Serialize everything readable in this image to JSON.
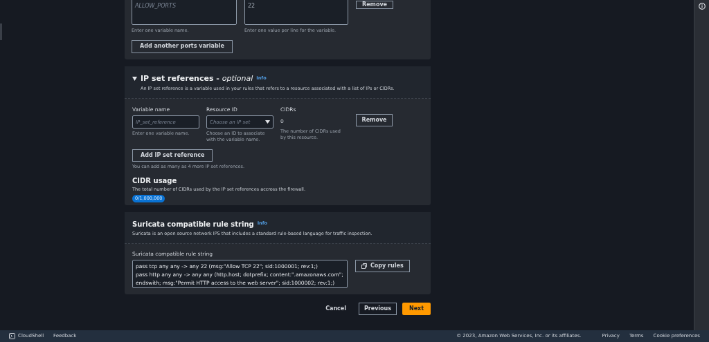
{
  "ports_section": {
    "variable_field": {
      "placeholder": "ALLOW_PORTS",
      "hint": "Enter one variable name."
    },
    "values_field": {
      "value": "22",
      "hint": "Enter one value per line for the variable."
    },
    "remove_button": "Remove",
    "add_button": "Add another ports variable"
  },
  "ip_set_section": {
    "expanded": true,
    "title": "IP set references - ",
    "title_suffix": "optional",
    "info": "Info",
    "description": "An IP set reference is a variable used in your rules that refers to a resource associated with a list of IPs or CIDRs.",
    "variable_name": {
      "label": "Variable name",
      "placeholder": "IP_set_reference",
      "hint": "Enter one variable name."
    },
    "resource_id": {
      "label": "Resource ID",
      "placeholder": "Choose an IP set",
      "hint": "Choose an ID to associate with the variable name."
    },
    "cidrs": {
      "label": "CIDRs",
      "value": "0",
      "hint": "The number of CIDRs used by this resource."
    },
    "remove_button": "Remove",
    "add_button": "Add IP set reference",
    "add_hint": "You can add as many as 4 more IP set references.",
    "cidr_usage": {
      "title": "CIDR usage",
      "description": "The total number of CIDRs used by the IP set references accross the firewall.",
      "badge": "0/1,000,000"
    }
  },
  "suricata_section": {
    "title": "Suricata compatible rule string",
    "info": "Info",
    "description": "Suricata is an open source network IPS that includes a standard rule-based language for traffic inspection.",
    "field_label": "Suricata compatible rule string",
    "lines": [
      "pass tcp any any -> any 22 (msg:\"Allow TCP 22\"; sid:1000001; rev:1;)",
      "pass http any any -> any any (http.host; dotprefix; content:\".amazonaws.com\";",
      "endswith; msg:\"Permit HTTP access to the web server\"; sid:1000002; rev:1;)"
    ],
    "copy_button": "Copy rules"
  },
  "actions": {
    "cancel": "Cancel",
    "previous": "Previous",
    "next": "Next"
  },
  "footer": {
    "cloudshell": "CloudShell",
    "feedback": "Feedback",
    "copyright": "© 2023, Amazon Web Services, Inc. or its affiliates.",
    "links": [
      "Privacy",
      "Terms",
      "Cookie preferences"
    ]
  }
}
